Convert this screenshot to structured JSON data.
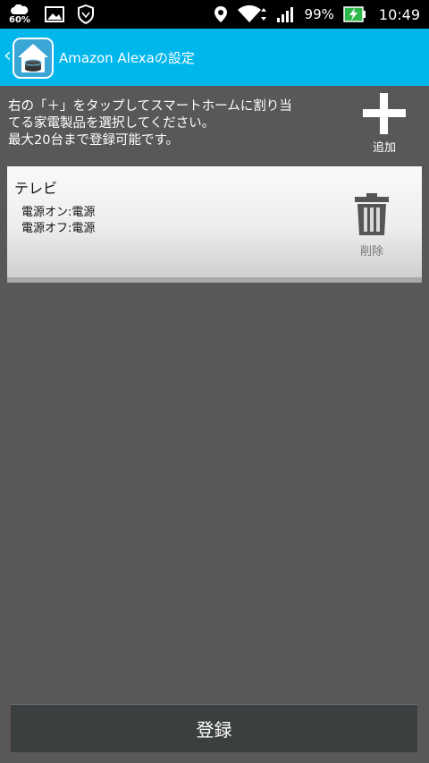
{
  "status_bar": {
    "weather_pct": "60%",
    "battery_pct": "99%",
    "time": "10:49"
  },
  "header": {
    "title": "Amazon Alexaの設定"
  },
  "instructions": "右の「＋」をタップしてスマートホームに割り当\nてる家電製品を選択してください。\n最大20台まで登録可能です。",
  "add_button": {
    "label": "追加",
    "icon": "plus-icon"
  },
  "devices": [
    {
      "name": "テレビ",
      "power_on": "電源オン:電源",
      "power_off": "電源オフ:電源",
      "delete_label": "削除"
    }
  ],
  "register_button": {
    "label": "登録"
  },
  "colors": {
    "header": "#00b7ec",
    "background": "#595856",
    "register_button": "#3c3f40"
  }
}
